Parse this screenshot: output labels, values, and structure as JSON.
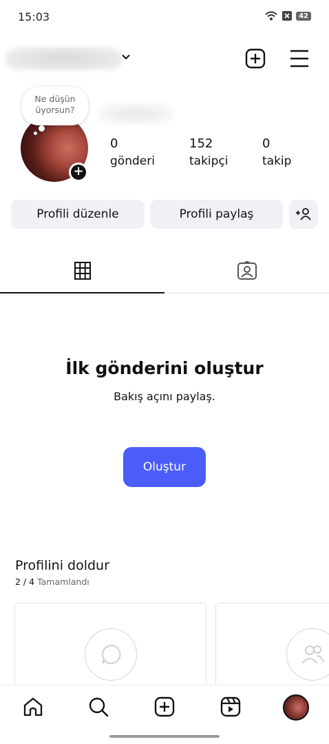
{
  "status_bar": {
    "time": "15:03",
    "battery": "42"
  },
  "note": {
    "line1": "Ne düşün",
    "line2": "üyorsun?"
  },
  "stats": [
    {
      "value": "0",
      "label": "gönderi"
    },
    {
      "value": "152",
      "label": "takipçi"
    },
    {
      "value": "0",
      "label": "takip"
    }
  ],
  "actions": {
    "edit_profile": "Profili düzenle",
    "share_profile": "Profili paylaş"
  },
  "empty_state": {
    "title": "İlk gönderini oluştur",
    "subtitle": "Bakış açını paylaş.",
    "create_button": "Oluştur"
  },
  "complete_profile": {
    "title": "Profilini doldur",
    "progress": "2 / 4",
    "progress_suffix": "Tamamlandı"
  },
  "colors": {
    "accent": "#4a5df9",
    "button_bg": "#eff1f5"
  },
  "icons": {
    "header": [
      "chevron-down-icon",
      "new-post-icon",
      "menu-icon"
    ],
    "tabs": [
      "grid-icon",
      "tagged-icon"
    ],
    "nav": [
      "home-icon",
      "search-icon",
      "create-icon",
      "reels-icon",
      "profile-avatar"
    ]
  }
}
